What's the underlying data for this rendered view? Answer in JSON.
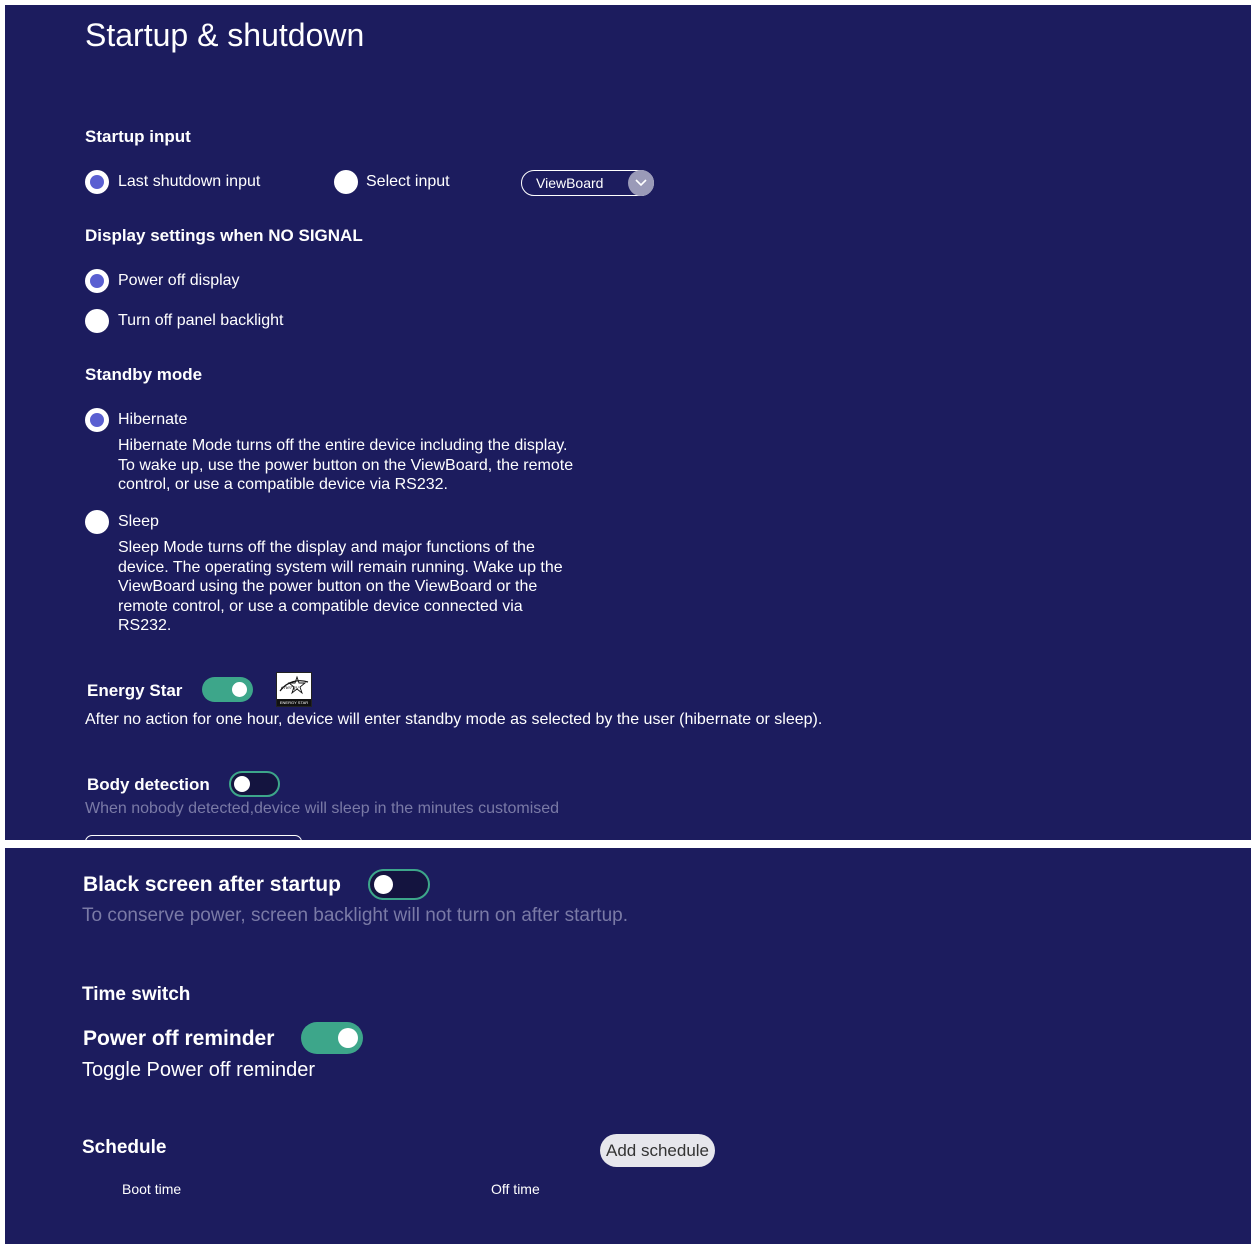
{
  "top": {
    "title": "Startup & shutdown",
    "startup_input": {
      "heading": "Startup input",
      "options": [
        {
          "label": "Last shutdown input",
          "selected": true
        },
        {
          "label": "Select input",
          "selected": false
        }
      ],
      "dropdown_value": "ViewBoard"
    },
    "no_signal": {
      "heading": "Display settings when NO SIGNAL",
      "options": [
        {
          "label": "Power off display",
          "selected": true
        },
        {
          "label": "Turn off panel backlight",
          "selected": false
        }
      ]
    },
    "standby": {
      "heading": "Standby mode",
      "hibernate": {
        "label": "Hibernate",
        "selected": true,
        "description": "Hibernate Mode turns off the entire device including the display. To wake up, use the power button on the ViewBoard, the remote control, or use a compatible device via RS232."
      },
      "sleep": {
        "label": "Sleep",
        "selected": false,
        "description": "Sleep Mode turns off the display and major functions of the device. The operating system will remain running. Wake up the ViewBoard using the power button on the ViewBoard or the remote control, or use a compatible device connected via RS232."
      }
    },
    "energy_star": {
      "label": "Energy Star",
      "enabled": true,
      "logo_text": "ENERGY STAR",
      "description": "After no action for one hour, device will enter standby mode as selected by the user (hibernate or sleep)."
    },
    "body_detection": {
      "label": "Body detection",
      "enabled": false,
      "description": "When nobody detected,device will sleep in the minutes customised"
    }
  },
  "bottom": {
    "black_screen": {
      "label": "Black screen after startup",
      "enabled": false,
      "description": "To conserve power, screen backlight will not turn on after startup."
    },
    "time_switch": {
      "heading": "Time switch"
    },
    "power_off_reminder": {
      "label": "Power off reminder",
      "enabled": true,
      "description": "Toggle Power off reminder"
    },
    "schedule": {
      "heading": "Schedule",
      "add_button": "Add schedule",
      "columns": [
        "Boot time",
        "Off time"
      ]
    }
  },
  "colors": {
    "background": "#1c1c5e",
    "radio_selected": "#5a5fd1",
    "toggle_on": "#3da68a"
  }
}
